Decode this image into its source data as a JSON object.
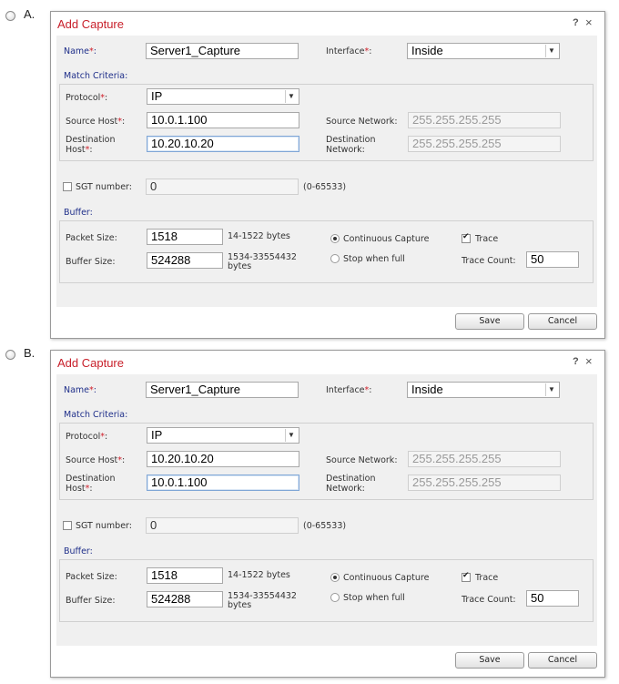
{
  "options": [
    {
      "letter": "A.",
      "dialog": {
        "title": "Add Capture",
        "help_symbol": "?",
        "close_symbol": "×",
        "name_label": "Name",
        "name_value": "Server1_Capture",
        "interface_label": "Interface",
        "interface_value": "Inside",
        "match_criteria_label": "Match Criteria:",
        "protocol_label": "Protocol",
        "protocol_value": "IP",
        "source_host_label": "Source Host",
        "source_host_value": "10.0.1.100",
        "source_network_label": "Source Network:",
        "source_network_value": "255.255.255.255",
        "dest_host_label_1": "Destination",
        "dest_host_label_2": "Host",
        "dest_host_value": "10.20.10.20",
        "dest_network_label_1": "Destination",
        "dest_network_label_2": "Network:",
        "dest_network_value": "255.255.255.255",
        "sgt_label": "SGT number:",
        "sgt_value": "0",
        "sgt_range": "(0-65533)",
        "buffer_label": "Buffer:",
        "packet_size_label": "Packet Size:",
        "packet_size_value": "1518",
        "packet_size_hint": "14-1522 bytes",
        "buffer_size_label": "Buffer Size:",
        "buffer_size_value": "524288",
        "buffer_size_hint_1": "1534-33554432",
        "buffer_size_hint_2": "bytes",
        "continuous_capture_label": "Continuous Capture",
        "stop_when_full_label": "Stop when full",
        "trace_label": "Trace",
        "trace_count_label": "Trace Count:",
        "trace_count_value": "50",
        "save_label": "Save",
        "cancel_label": "Cancel"
      }
    },
    {
      "letter": "B.",
      "dialog": {
        "title": "Add Capture",
        "help_symbol": "?",
        "close_symbol": "×",
        "name_label": "Name",
        "name_value": "Server1_Capture",
        "interface_label": "Interface",
        "interface_value": "Inside",
        "match_criteria_label": "Match Criteria:",
        "protocol_label": "Protocol",
        "protocol_value": "IP",
        "source_host_label": "Source Host",
        "source_host_value": "10.20.10.20",
        "source_network_label": "Source Network:",
        "source_network_value": "255.255.255.255",
        "dest_host_label_1": "Destination",
        "dest_host_label_2": "Host",
        "dest_host_value": "10.0.1.100",
        "dest_network_label_1": "Destination",
        "dest_network_label_2": "Network:",
        "dest_network_value": "255.255.255.255",
        "sgt_label": "SGT number:",
        "sgt_value": "0",
        "sgt_range": "(0-65533)",
        "buffer_label": "Buffer:",
        "packet_size_label": "Packet Size:",
        "packet_size_value": "1518",
        "packet_size_hint": "14-1522 bytes",
        "buffer_size_label": "Buffer Size:",
        "buffer_size_value": "524288",
        "buffer_size_hint_1": "1534-33554432",
        "buffer_size_hint_2": "bytes",
        "continuous_capture_label": "Continuous Capture",
        "stop_when_full_label": "Stop when full",
        "trace_label": "Trace",
        "trace_count_label": "Trace Count:",
        "trace_count_value": "50",
        "save_label": "Save",
        "cancel_label": "Cancel"
      }
    }
  ],
  "colors": {
    "title_red": "#c8202b",
    "section_blue": "#1f2f8a",
    "body_gray": "#f0f0f0"
  }
}
